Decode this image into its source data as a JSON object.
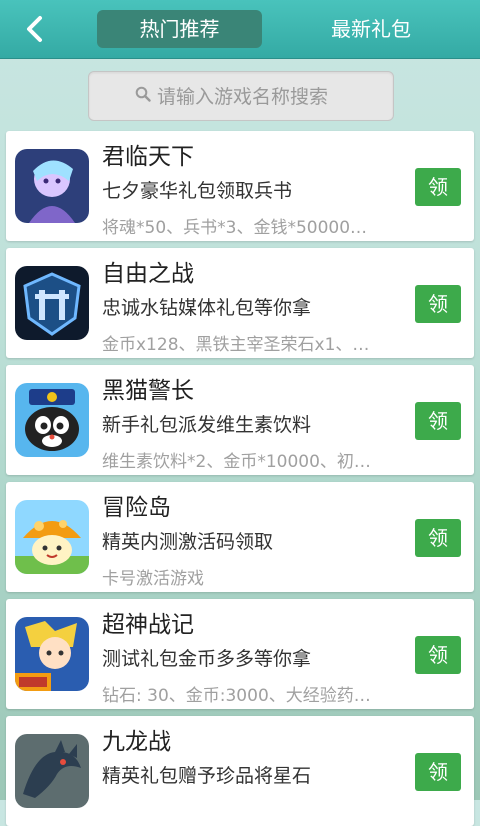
{
  "header": {
    "tabs": [
      {
        "label": "热门推荐",
        "active": true
      },
      {
        "label": "最新礼包",
        "active": false
      }
    ]
  },
  "search": {
    "placeholder": "请输入游戏名称搜索"
  },
  "games": [
    {
      "name": "君临天下",
      "gift": "七夕豪华礼包领取兵书",
      "contents": "将魂*50、兵书*3、金钱*50000…",
      "action": "领",
      "icon": "warrior-avatar-icon"
    },
    {
      "name": "自由之战",
      "gift": "忠诚水钻媒体礼包等你拿",
      "contents": "金币x128、黑铁主宰圣荣石x1、…",
      "action": "领",
      "icon": "shield-logo-icon"
    },
    {
      "name": "黑猫警长",
      "gift": "新手礼包派发维生素饮料",
      "contents": "维生素饮料*2、金币*10000、初…",
      "action": "领",
      "icon": "black-cat-icon"
    },
    {
      "name": "冒险岛",
      "gift": "精英内测激活码领取",
      "contents": "卡号激活游戏",
      "action": "领",
      "icon": "mushroom-icon"
    },
    {
      "name": "超神战记",
      "gift": "测试礼包金币多多等你拿",
      "contents": "钻石: 30、金币:3000、大经验药…",
      "action": "领",
      "icon": "hero-avatar-icon"
    },
    {
      "name": "九龙战",
      "gift": "精英礼包赠予珍品将星石",
      "contents": "",
      "action": "领",
      "icon": "dragon-icon"
    }
  ]
}
